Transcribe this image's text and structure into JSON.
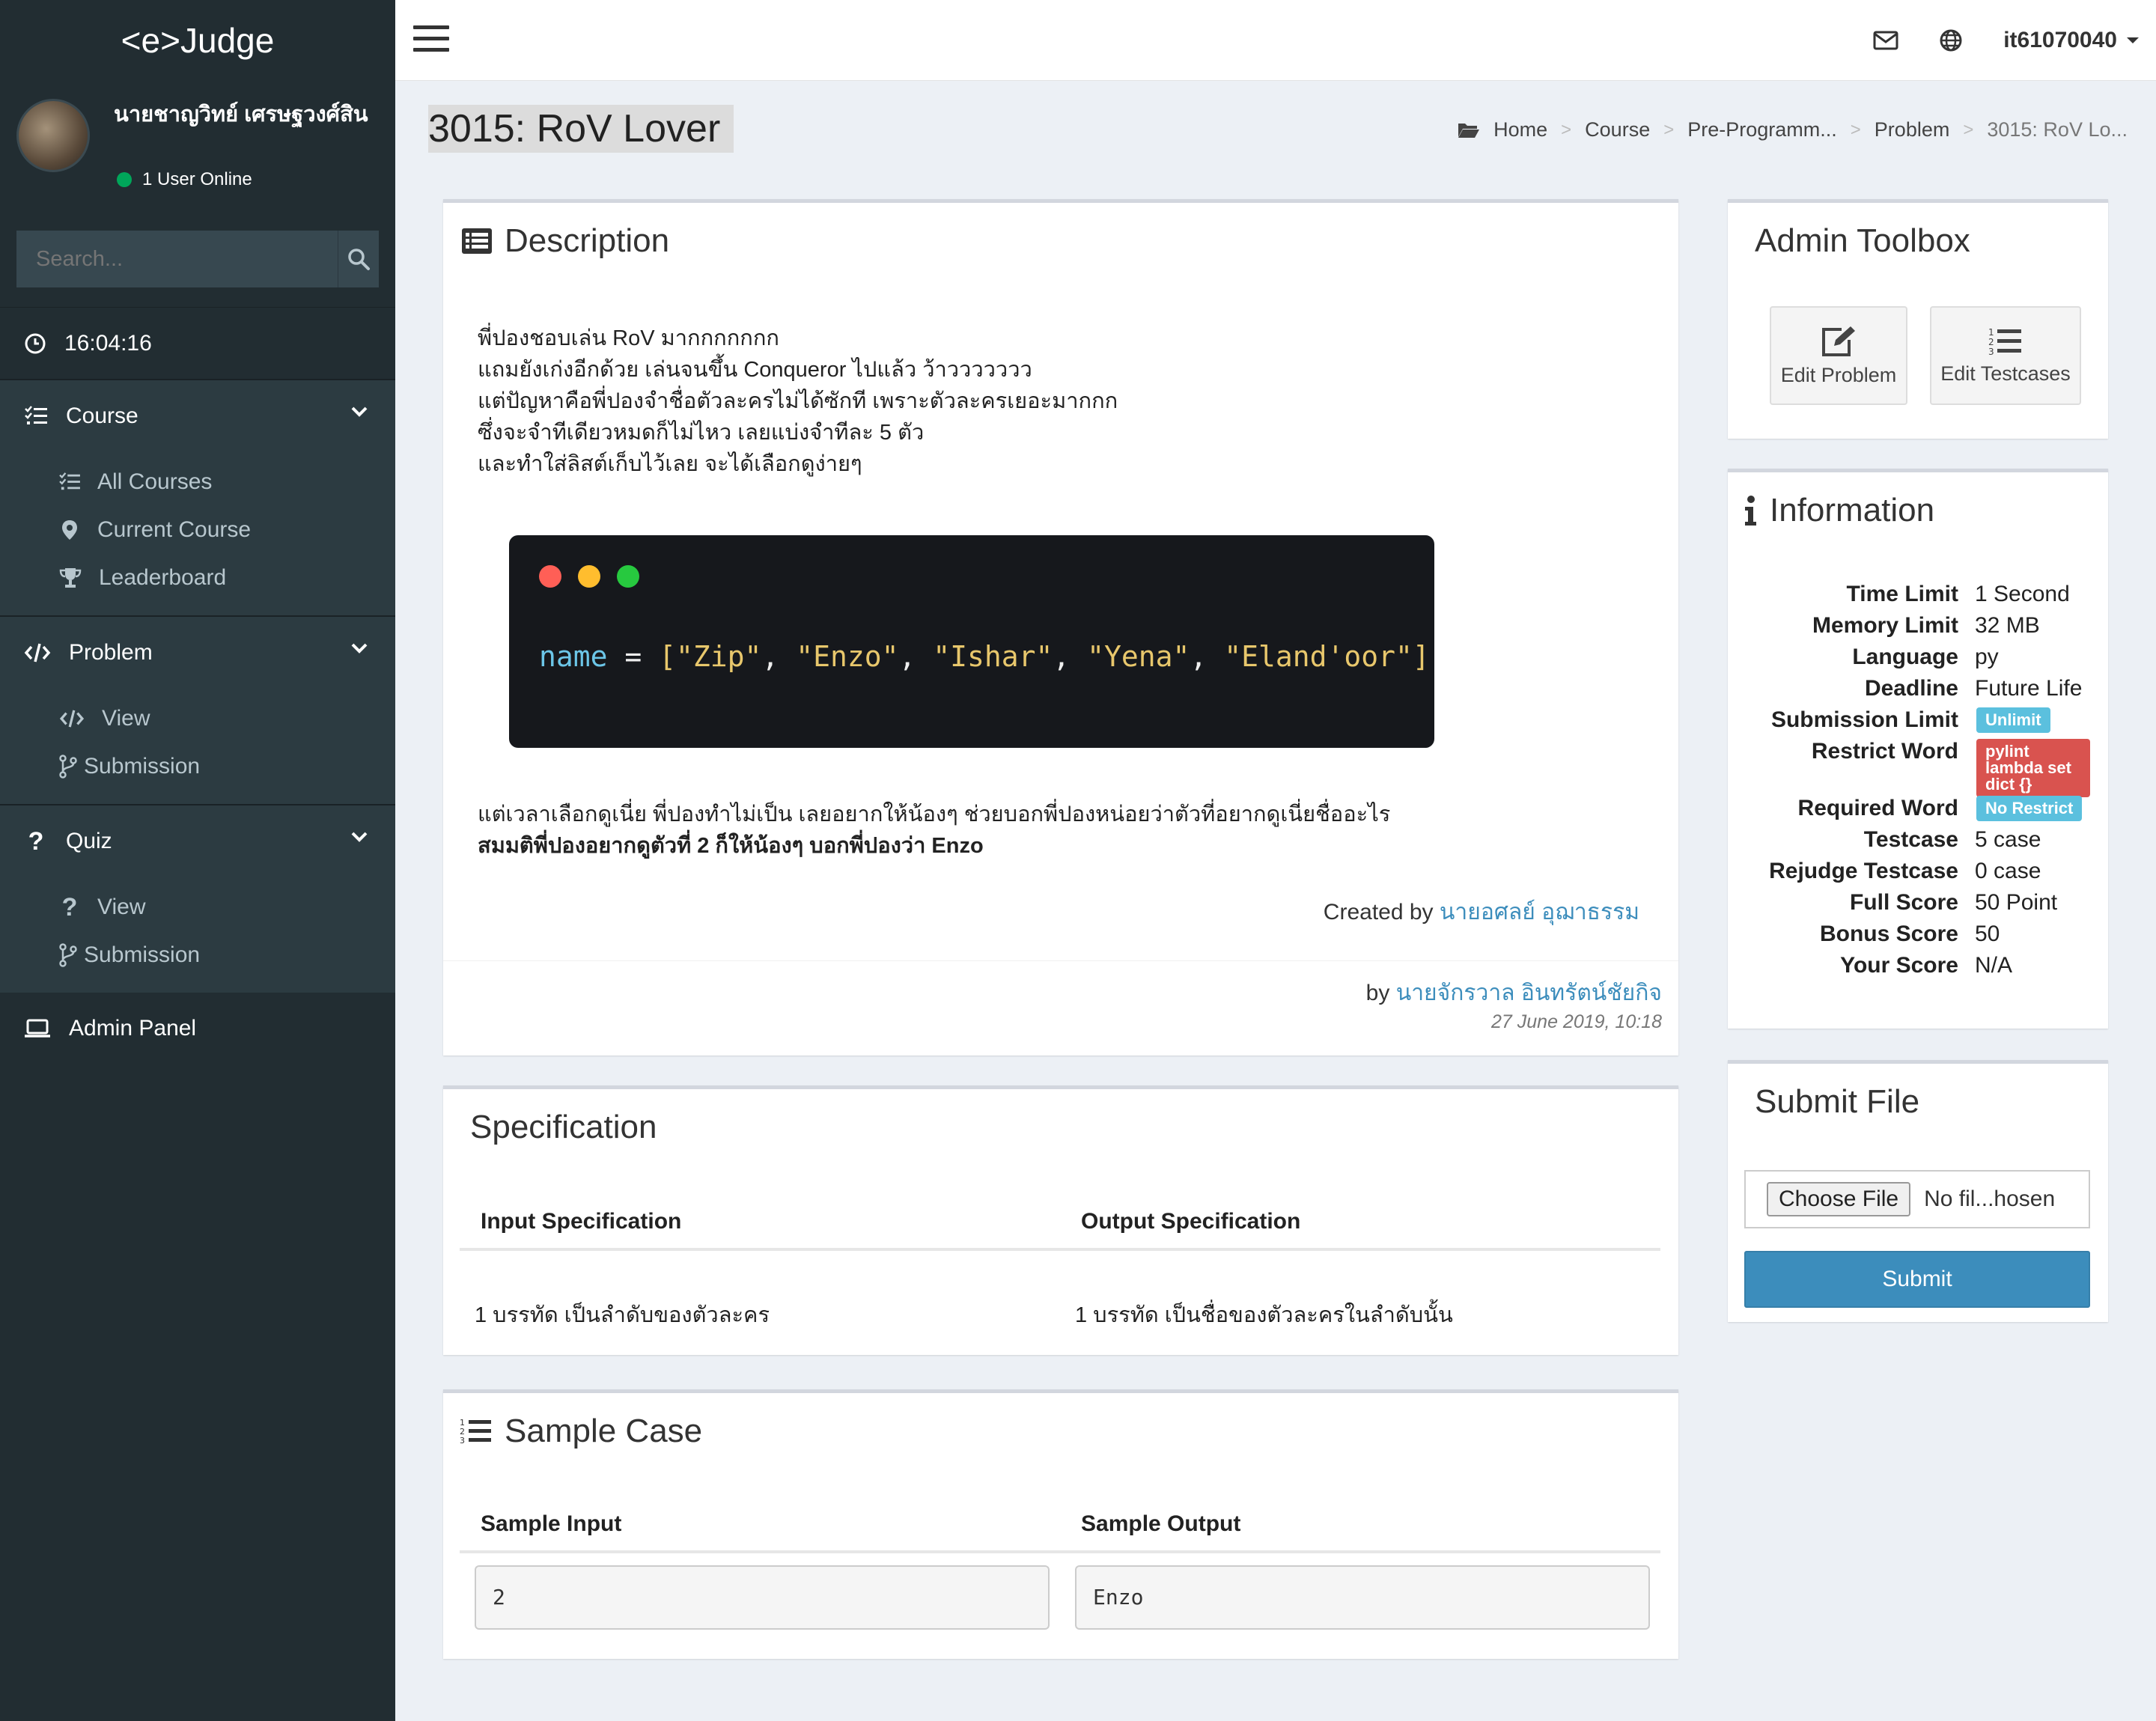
{
  "app": {
    "logo": "<e>Judge"
  },
  "user": {
    "name": "นายชาญวิทย์ เศรษฐวงศ์สิน",
    "online": "1 User Online"
  },
  "search": {
    "placeholder": "Search..."
  },
  "clock": "16:04:16",
  "menu": {
    "course": {
      "label": "Course",
      "items": [
        "All Courses",
        "Current Course",
        "Leaderboard"
      ]
    },
    "problem": {
      "label": "Problem",
      "items": [
        "View",
        "Submission"
      ]
    },
    "quiz": {
      "label": "Quiz",
      "items": [
        "View",
        "Submission"
      ]
    },
    "admin": "Admin Panel"
  },
  "topbar": {
    "username": "it61070040"
  },
  "page": {
    "title": "3015: RoV Lover",
    "breadcrumb": [
      "Home",
      "Course",
      "Pre-Programm...",
      "Problem",
      "3015: RoV Lo..."
    ]
  },
  "description": {
    "title": "Description",
    "lines": [
      "พี่ปองชอบเล่น RoV มากกกกกกก",
      "แถมยังเก่งอีกด้วย เล่นจนขึ้น Conqueror ไปแล้ว ว้าววววววว",
      "แต่ปัญหาคือพี่ปองจำชื่อตัวละครไม่ได้ซักที เพราะตัวละครเยอะมากกก",
      "ซึ่งจะจำทีเดียวหมดก็ไม่ไหว เลยแบ่งจำทีละ 5 ตัว",
      "และทำใส่ลิสต์เก็บไว้เลย จะได้เลือกดูง่ายๆ"
    ],
    "code": {
      "var": "name",
      "op": " = ",
      "open": "[",
      "strings": [
        "\"Zip\"",
        "\"Enzo\"",
        "\"Ishar\"",
        "\"Yena\"",
        "\"Eland'oor\""
      ],
      "close": "]"
    },
    "after_line": "แต่เวลาเลือกดูเนี่ย พี่ปองทำไม่เป็น เลยอยากให้น้องๆ ช่วยบอกพี่ปองหน่อยว่าตัวที่อยากดูเนี่ยชื่ออะไร",
    "bold_line": "สมมติพี่ปองอยากดูตัวที่ 2 ก็ให้น้องๆ บอกพี่ปองว่า Enzo",
    "created_label": "Created by",
    "created_by": "นายอศลย์ อุฌาธรรม",
    "by_label": "by",
    "by": "นายจักรวาล อินทรัตน์ชัยกิจ",
    "date": "27 June 2019, 10:18"
  },
  "specification": {
    "title": "Specification",
    "input_header": "Input Specification",
    "output_header": "Output Specification",
    "input": "1 บรรทัด เป็นลำดับของตัวละคร",
    "output": "1 บรรทัด เป็นชื่อของตัวละครในลำดับนั้น"
  },
  "sample": {
    "title": "Sample Case",
    "input_header": "Sample Input",
    "output_header": "Sample Output",
    "input": "2",
    "output": "Enzo"
  },
  "toolbox": {
    "title": "Admin Toolbox",
    "edit_problem": "Edit Problem",
    "edit_testcases": "Edit Testcases"
  },
  "information": {
    "title": "Information",
    "time_limit": {
      "key": "Time Limit",
      "value": "1 Second"
    },
    "memory_limit": {
      "key": "Memory Limit",
      "value": "32 MB"
    },
    "language": {
      "key": "Language",
      "value": "py"
    },
    "deadline": {
      "key": "Deadline",
      "value": "Future Life"
    },
    "submission_limit": {
      "key": "Submission Limit",
      "value": "Unlimit"
    },
    "restrict_word": {
      "key": "Restrict Word",
      "value": "pylint lambda set dict {}"
    },
    "required_word": {
      "key": "Required Word",
      "value": "No Restrict"
    },
    "testcase": {
      "key": "Testcase",
      "value": "5 case"
    },
    "rejudge": {
      "key": "Rejudge Testcase",
      "value": "0 case"
    },
    "full_score": {
      "key": "Full Score",
      "value": "50 Point"
    },
    "bonus_score": {
      "key": "Bonus Score",
      "value": "50"
    },
    "your_score": {
      "key": "Your Score",
      "value": "N/A"
    }
  },
  "submit": {
    "title": "Submit File",
    "choose": "Choose File",
    "no_file": "No fil...hosen",
    "submit": "Submit"
  },
  "colors": {
    "sidebar": "#222d32",
    "accent": "#3c8dbc",
    "badge_blue": "#5bc0de",
    "badge_red": "#d9534f",
    "online": "#00a65a"
  }
}
